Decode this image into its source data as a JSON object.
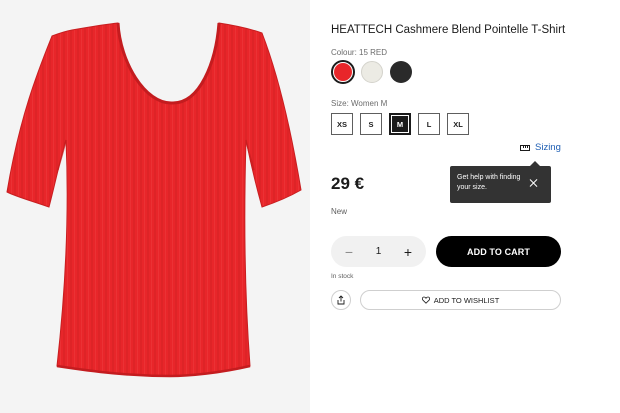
{
  "product": {
    "title": "HEATTECH Cashmere Blend Pointelle T-Shirt",
    "colour_label": "Colour: 15 RED",
    "colours": [
      {
        "name": "red",
        "hex": "#e8262a",
        "selected": true
      },
      {
        "name": "off-white",
        "hex": "#ecebe4",
        "selected": false
      },
      {
        "name": "black",
        "hex": "#2a2a2a",
        "selected": false
      }
    ],
    "size_label": "Size: Women M",
    "sizes": [
      "XS",
      "S",
      "M",
      "L",
      "XL"
    ],
    "selected_size": "M",
    "sizing_link": "Sizing",
    "tooltip_text": "Get help with finding your size.",
    "price": "29 €",
    "badge": "New",
    "quantity": "1",
    "quantity_minus": "−",
    "quantity_plus": "+",
    "add_to_cart": "ADD TO CART",
    "stock_status": "In stock",
    "wishlist_label": "ADD TO WISHLIST"
  },
  "colors": {
    "garment": "#e8262a",
    "garment_shadow": "#c81e20",
    "image_background": "#f4f4f4",
    "link": "#1f5fb4",
    "tooltip_bg": "#333333"
  },
  "icons": {
    "sizing": "ruler-icon",
    "tooltip_close": "close-icon",
    "share": "share-icon",
    "wishlist": "heart-icon"
  }
}
